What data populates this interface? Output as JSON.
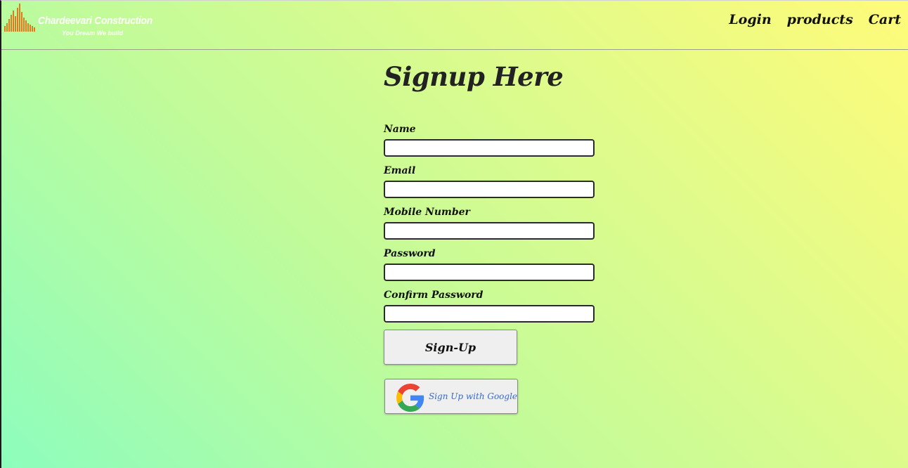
{
  "header": {
    "brand_title": "Chardeevari Construction",
    "brand_tagline": "You Dream We build",
    "nav": [
      {
        "label": "Login"
      },
      {
        "label": "products"
      },
      {
        "label": "Cart"
      }
    ]
  },
  "form": {
    "title": "Signup Here",
    "fields": [
      {
        "label": "Name",
        "value": "",
        "placeholder": ""
      },
      {
        "label": "Email",
        "value": "",
        "placeholder": ""
      },
      {
        "label": "Mobile Number",
        "value": "",
        "placeholder": ""
      },
      {
        "label": "Password",
        "value": "",
        "placeholder": ""
      },
      {
        "label": "Confirm Password",
        "value": "",
        "placeholder": ""
      }
    ],
    "submit_label": "Sign-Up",
    "google_label": "Sign Up with Google"
  },
  "colors": {
    "logo_orange": "#e07a1f",
    "google_text": "#2f6bd8",
    "gradient_start": "#8dfdbd",
    "gradient_end": "#fffb79"
  },
  "icons": {
    "logo": "building-bars-icon",
    "google": "google-g-icon"
  }
}
